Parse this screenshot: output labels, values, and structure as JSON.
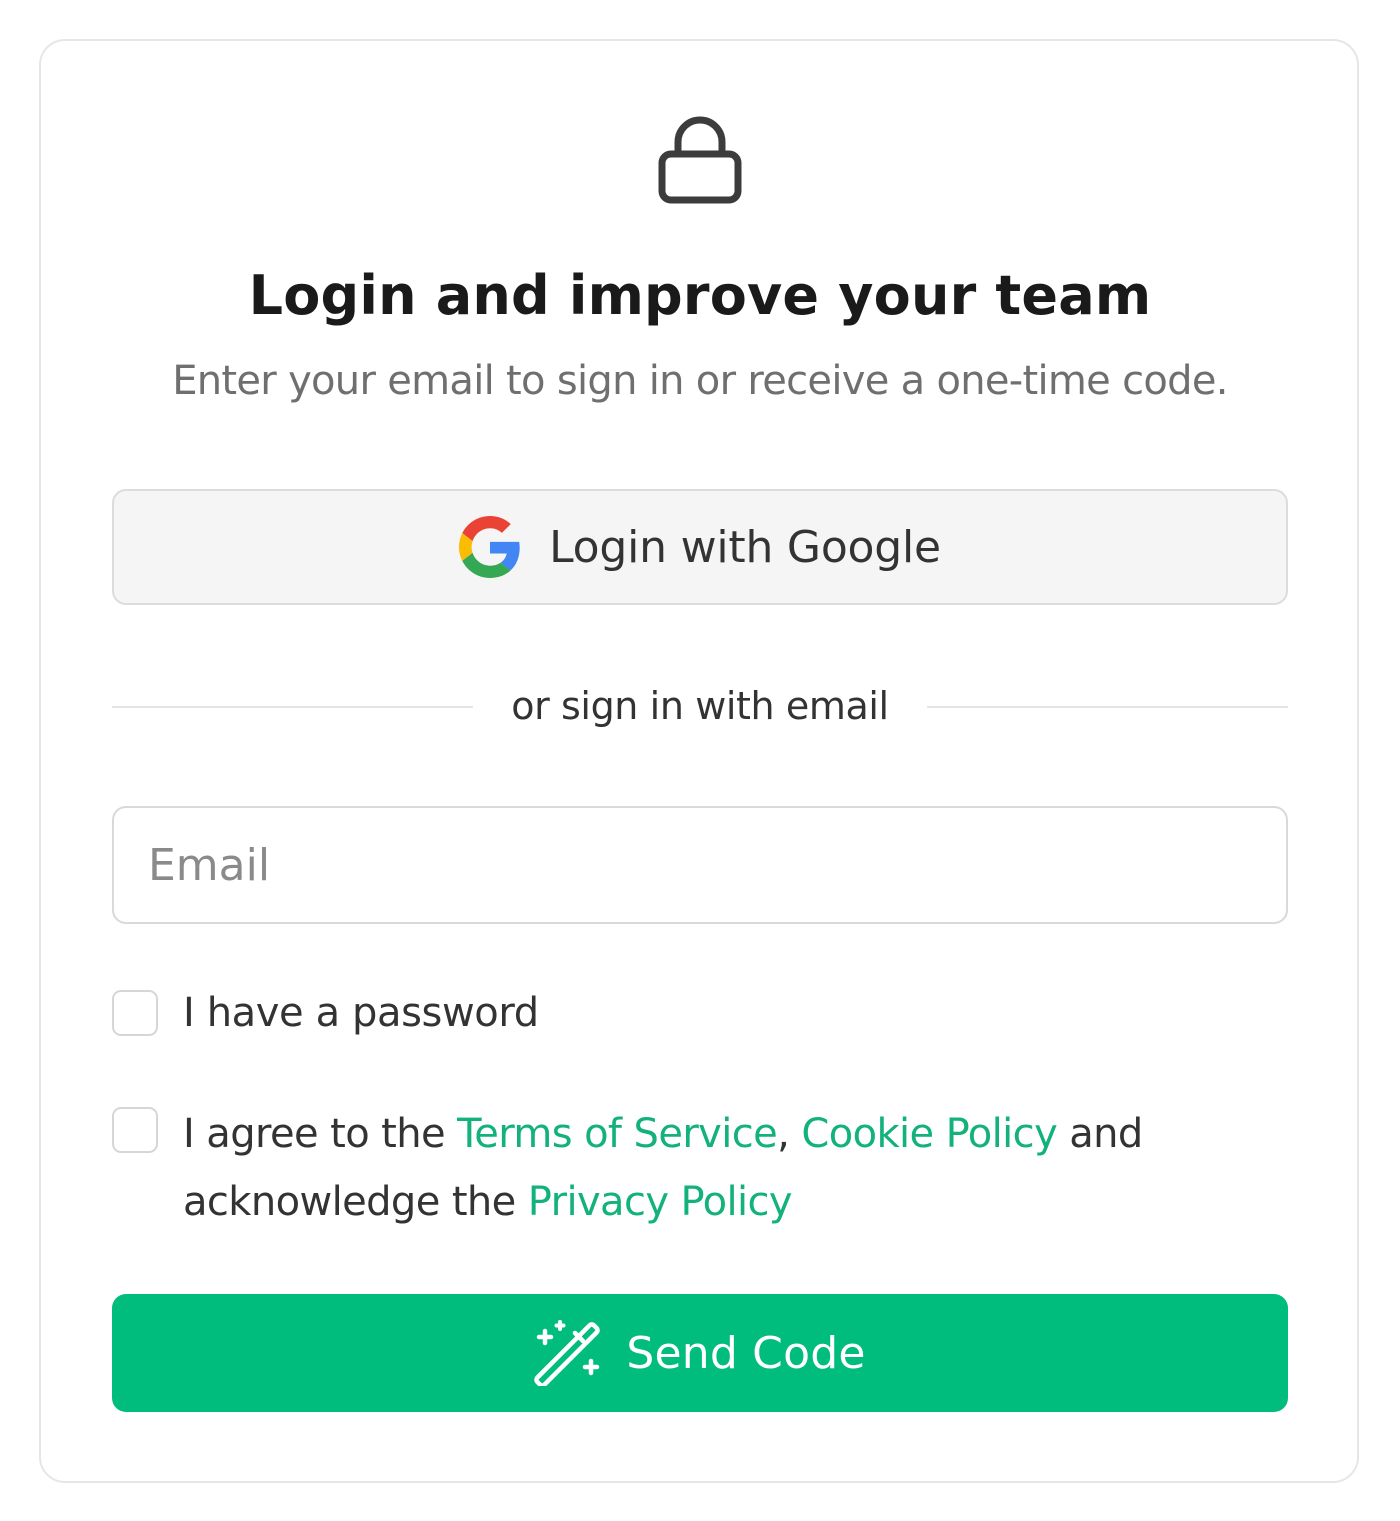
{
  "title": "Login and improve your team",
  "subtitle": "Enter your email to sign in or receive a one-time code.",
  "google_button": {
    "label": "Login with Google",
    "icon": "google-icon"
  },
  "divider": {
    "text": "or sign in with email"
  },
  "email": {
    "placeholder": "Email",
    "value": ""
  },
  "password_checkbox": {
    "label": "I have a password",
    "checked": false
  },
  "terms_checkbox": {
    "checked": false,
    "text_prefix": "I agree to the ",
    "terms_link": "Terms of Service",
    "comma": ", ",
    "cookie_link": "Cookie Policy",
    "middle": " and acknowledge the ",
    "privacy_link": "Privacy Policy"
  },
  "send_button": {
    "label": "Send Code",
    "icon": "magic-wand-icon"
  },
  "icons": {
    "header": "lock-icon"
  },
  "colors": {
    "accent": "#00bd7e",
    "link": "#12b27a",
    "text": "#1a1a1a",
    "muted": "#6f6f6f"
  }
}
